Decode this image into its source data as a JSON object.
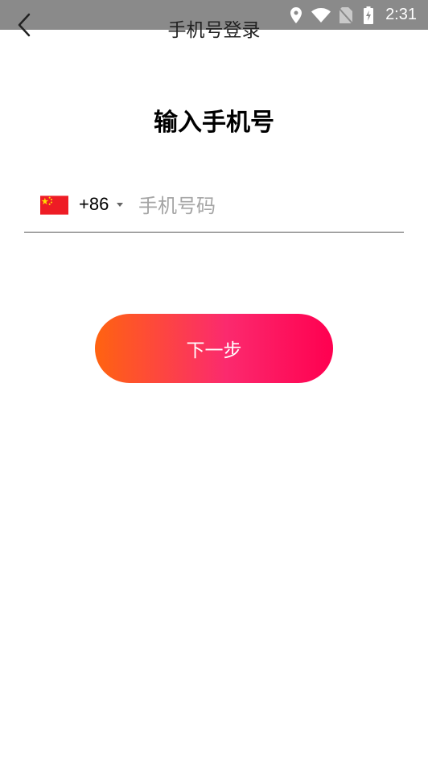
{
  "status_bar": {
    "time": "2:31",
    "icons": [
      "location-icon",
      "wifi-icon",
      "no-sim-icon",
      "battery-charging-icon"
    ]
  },
  "header": {
    "title": "手机号登录",
    "back_icon": "chevron-left-icon"
  },
  "main": {
    "heading": "输入手机号",
    "country": {
      "flag": "china-flag-icon",
      "code": "+86"
    },
    "phone_input": {
      "value": "",
      "placeholder": "手机号码"
    },
    "next_button_label": "下一步"
  },
  "colors": {
    "status_bar_bg": "#8a8a8a",
    "button_gradient_start": "#ff6310",
    "button_gradient_end": "#ff0050",
    "divider": "#555555",
    "placeholder": "#a5a5a5"
  }
}
